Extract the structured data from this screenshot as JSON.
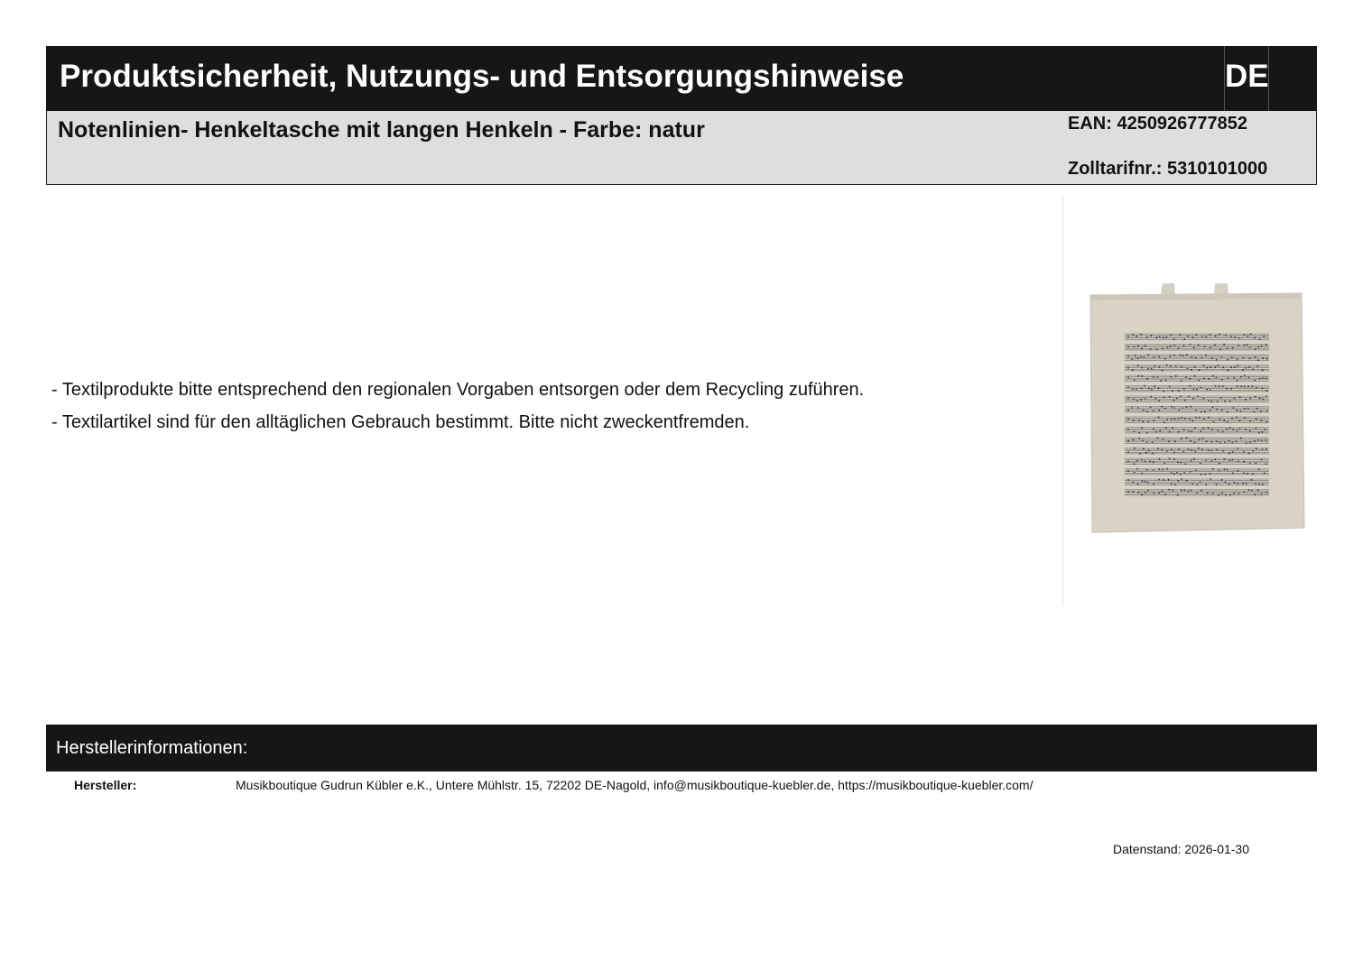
{
  "header": {
    "title": "Produktsicherheit, Nutzungs- und Entsorgungshinweise",
    "language": "DE"
  },
  "product": {
    "title": "Notenlinien- Henkeltasche mit langen Henkeln - Farbe: natur",
    "ean": "EAN: 4250926777852",
    "tariff": "Zolltarifnr.: 5310101000"
  },
  "hints": [
    "- Textilprodukte bitte entsprechend den regionalen Vorgaben entsorgen oder dem Recycling zuführen.",
    "- Textilartikel sind für den alltäglichen Gebrauch bestimmt. Bitte nicht zweckentfremden."
  ],
  "manufacturer": {
    "section_title": "Herstellerinformationen:",
    "label": "Hersteller:",
    "value": "Musikboutique Gudrun Kübler e.K., Untere Mühlstr. 15, 72202 DE-Nagold, info@musikboutique-kuebler.de, https://musikboutique-kuebler.com/"
  },
  "footer": {
    "date": "Datenstand: 2026-01-30"
  },
  "colors": {
    "bar": "#161616",
    "subheader": "#dedede",
    "bag": "#d9d3c6"
  }
}
